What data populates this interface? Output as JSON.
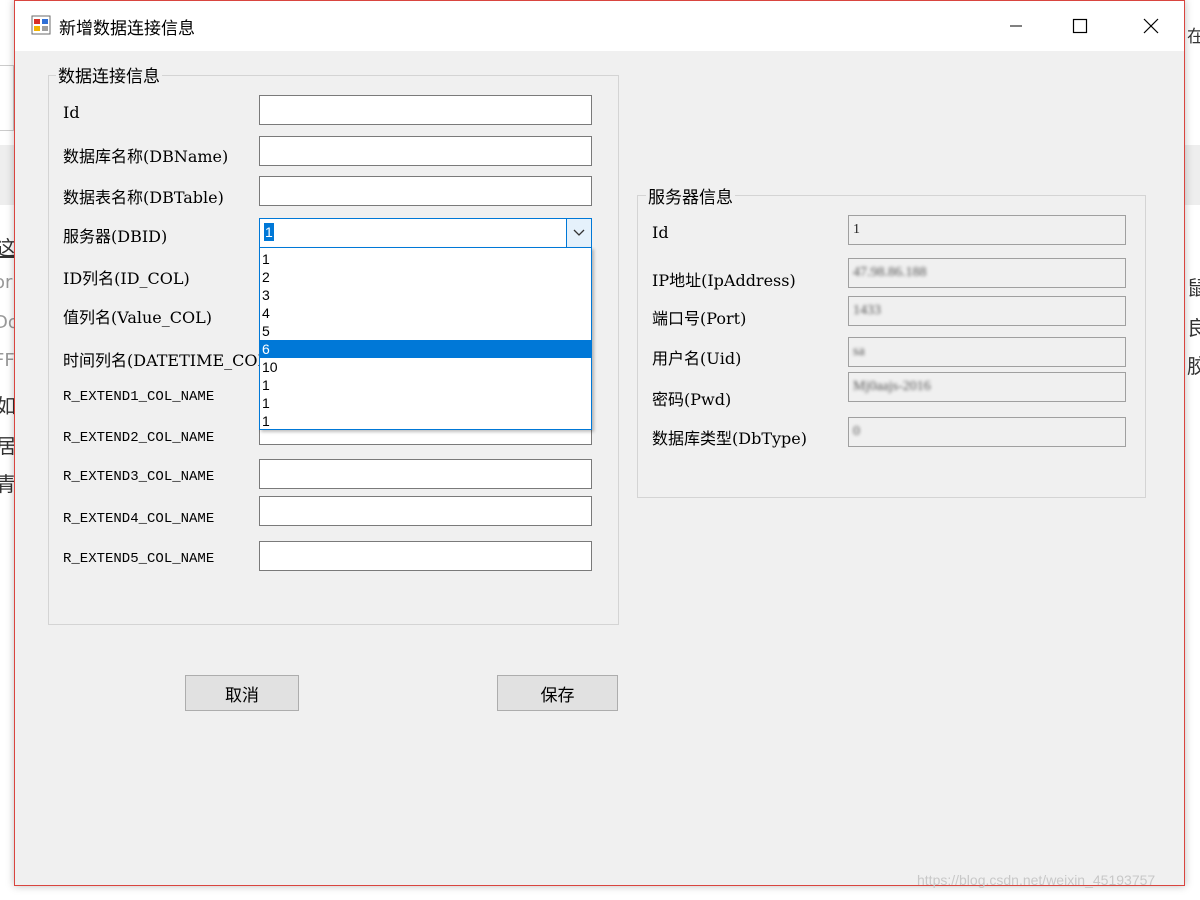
{
  "window": {
    "title": "新增数据连接信息"
  },
  "background": {
    "left_chars": [
      "这",
      "or",
      "Do",
      "FF",
      "如",
      "居",
      "青"
    ],
    "right_chars": [
      "在",
      "鼠",
      "良",
      "胶"
    ]
  },
  "left_group": {
    "title": "数据连接信息",
    "fields": [
      {
        "label": "Id",
        "value": ""
      },
      {
        "label": "数据库名称(DBName)",
        "value": ""
      },
      {
        "label": "数据表名称(DBTable)",
        "value": ""
      },
      {
        "label": "服务器(DBID)",
        "value": "1"
      },
      {
        "label": "ID列名(ID_COL)",
        "value": ""
      },
      {
        "label": "值列名(Value_COL)",
        "value": ""
      },
      {
        "label": "时间列名(DATETIME_COL)",
        "value": ""
      },
      {
        "label": "R_EXTEND1_COL_NAME",
        "value": ""
      },
      {
        "label": "R_EXTEND2_COL_NAME",
        "value": ""
      },
      {
        "label": "R_EXTEND3_COL_NAME",
        "value": ""
      },
      {
        "label": "R_EXTEND4_COL_NAME",
        "value": ""
      },
      {
        "label": "R_EXTEND5_COL_NAME",
        "value": ""
      }
    ],
    "dbid_options": [
      "1",
      "2",
      "3",
      "4",
      "5",
      "6",
      "10",
      "1",
      "1",
      "1"
    ],
    "dbid_highlighted": "6"
  },
  "right_group": {
    "title": "服务器信息",
    "fields": [
      {
        "label": "Id",
        "value": "1"
      },
      {
        "label": "IP地址(IpAddress)",
        "value": "47.98.86.188"
      },
      {
        "label": "端口号(Port)",
        "value": "1433"
      },
      {
        "label": "用户名(Uid)",
        "value": "sa"
      },
      {
        "label": "密码(Pwd)",
        "value": "Mj0aajs-2016"
      },
      {
        "label": "数据库类型(DbType)",
        "value": "0"
      }
    ]
  },
  "buttons": {
    "cancel": "取消",
    "save": "保存"
  },
  "watermark": "https://blog.csdn.net/weixin_45193757",
  "colors": {
    "accent": "#0078d7",
    "window_bg": "#f0f0f0",
    "window_border": "#d9453f"
  }
}
